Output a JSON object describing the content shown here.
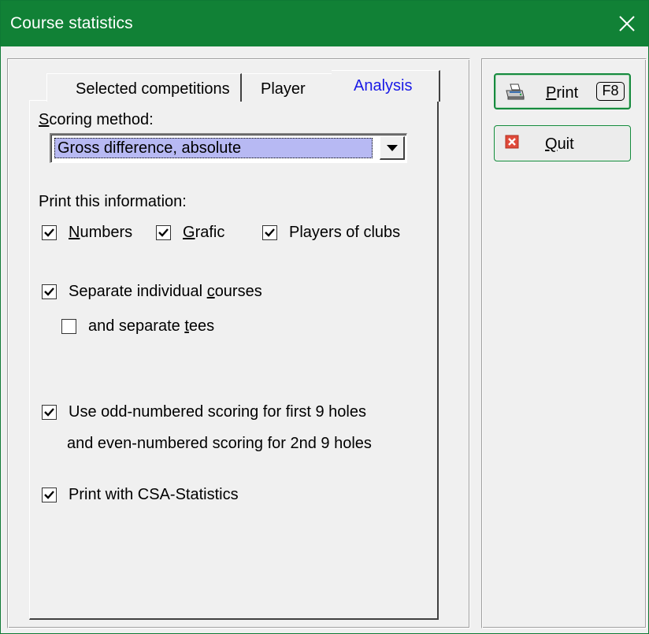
{
  "window": {
    "title": "Course statistics"
  },
  "tabs": [
    {
      "label": "Selected competitions"
    },
    {
      "label": "Player"
    },
    {
      "label": "Analysis"
    }
  ],
  "analysis": {
    "scoring_method_label": "Scoring method:",
    "scoring_method_value": "Gross difference, absolute",
    "print_info_label": "Print this information:",
    "numbers": {
      "label": "Numbers",
      "checked": true
    },
    "grafic": {
      "label": "Grafic",
      "checked": true
    },
    "players_of_clubs": {
      "label": "Players of clubs",
      "checked": true
    },
    "separate_courses": {
      "label": "Separate individual courses",
      "checked": true
    },
    "separate_tees": {
      "label": "and separate tees",
      "checked": false
    },
    "odd_scoring": {
      "label": "Use odd-numbered scoring for first 9 holes",
      "checked": true
    },
    "even_scoring_text": "and even-numbered scoring for 2nd 9 holes",
    "csa": {
      "label": "Print with CSA-Statistics",
      "checked": true
    }
  },
  "buttons": {
    "print": {
      "label": "Print",
      "shortcut": "F8",
      "icon": "printer-icon"
    },
    "quit": {
      "label": "Quit",
      "icon": "red-x-icon"
    }
  },
  "colors": {
    "titlebar": "#118136",
    "active_tab_text": "#1a1ae6",
    "selection": "#b7b9f3"
  }
}
